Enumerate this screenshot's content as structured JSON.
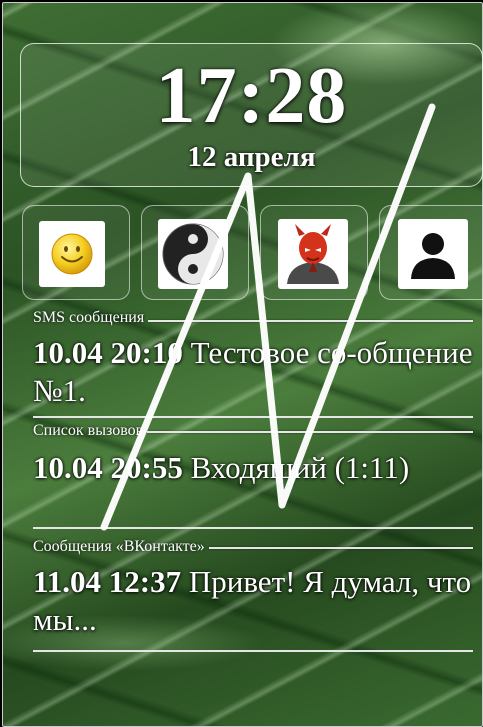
{
  "clock": {
    "time": "17:28",
    "date": "12 апреля"
  },
  "shortcuts": [
    {
      "name": "smiley",
      "icon": "smiley-icon"
    },
    {
      "name": "yin-yang",
      "icon": "yin-yang-icon"
    },
    {
      "name": "devil-user",
      "icon": "devil-user-icon"
    },
    {
      "name": "contact",
      "icon": "person-icon"
    }
  ],
  "feed": [
    {
      "title": "SMS сообщения",
      "timestamp": "10.04 20:10",
      "text": "Тестовое со-общение №1."
    },
    {
      "title": "Список вызовов",
      "timestamp": "10.04 20:55",
      "text": "Входящий (1:11)"
    },
    {
      "title": "Сообщения «ВКонтакте»",
      "timestamp": "11.04 12:37",
      "text": "Привет! Я думал, что мы..."
    }
  ],
  "colors": {
    "text": "#ffffff",
    "panel_border": "#ffffff",
    "smiley_yellow": "#f2c314",
    "devil_red": "#d5321b"
  }
}
